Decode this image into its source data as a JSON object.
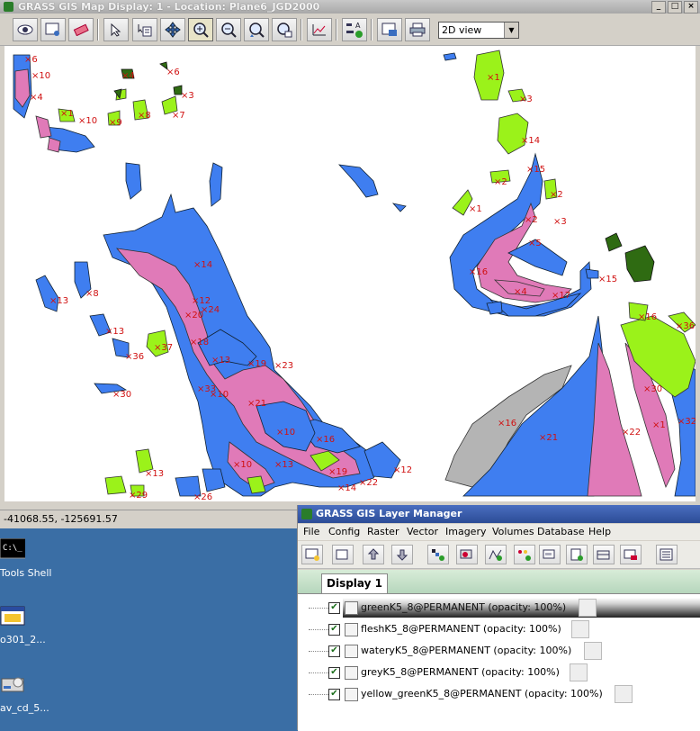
{
  "map_window": {
    "title": "GRASS GIS Map Display: 1 - Location: Plane6_JGD2000",
    "view_mode": "2D view",
    "coordinates": "-41068.55, -125691.57",
    "toolbar_icons": [
      "display-map-icon",
      "render-map-icon",
      "erase-display-icon",
      "pointer-icon",
      "query-icon",
      "pan-icon",
      "zoom-in-icon",
      "zoom-out-icon",
      "zoom-back-icon",
      "zoom-options-icon",
      "analyze-icon",
      "decorations-icon",
      "save-display-icon",
      "print-icon"
    ]
  },
  "desktop": {
    "icons": [
      {
        "label": "Tools Shell"
      },
      {
        "label": "o301_2..."
      },
      {
        "label": "av_cd_5..."
      }
    ]
  },
  "layer_manager": {
    "title": "GRASS GIS Layer Manager",
    "menu": [
      "File",
      "Config",
      "Raster",
      "Vector",
      "Imagery",
      "Volumes",
      "Database",
      "Help"
    ],
    "active_tab": "Display 1",
    "layers": [
      {
        "name": "greenK5_8@PERMANENT (opacity: 100%)",
        "checked": true,
        "selected": true
      },
      {
        "name": "fleshK5_8@PERMANENT (opacity: 100%)",
        "checked": true,
        "selected": false
      },
      {
        "name": "wateryK5_8@PERMANENT (opacity: 100%)",
        "checked": true,
        "selected": false
      },
      {
        "name": "greyK5_8@PERMANENT (opacity: 100%)",
        "checked": true,
        "selected": false
      },
      {
        "name": "yellow_greenK5_8@PERMANENT (opacity: 100%)",
        "checked": true,
        "selected": false
      }
    ]
  },
  "colors": {
    "watery": "#3f7ef0",
    "flesh": "#e07ab8",
    "yellow_green": "#9bf21a",
    "green": "#2f6b12",
    "grey": "#b4b4b4",
    "label_red": "#d01010"
  },
  "map_labels": [
    "6",
    "10",
    "4",
    "1",
    "10",
    "9",
    "8",
    "6",
    "3",
    "7",
    "4",
    "3",
    "1",
    "14",
    "15",
    "2",
    "2",
    "1",
    "2",
    "3",
    "5",
    "4",
    "16",
    "17",
    "15",
    "16",
    "36",
    "13",
    "8",
    "13",
    "36",
    "37",
    "14",
    "12",
    "18",
    "21",
    "20",
    "19",
    "10",
    "16",
    "14",
    "19",
    "12",
    "22",
    "13",
    "10",
    "26",
    "13",
    "29",
    "24",
    "23",
    "10",
    "30",
    "16",
    "21",
    "22",
    "1",
    "32",
    "30",
    "33",
    "13"
  ]
}
